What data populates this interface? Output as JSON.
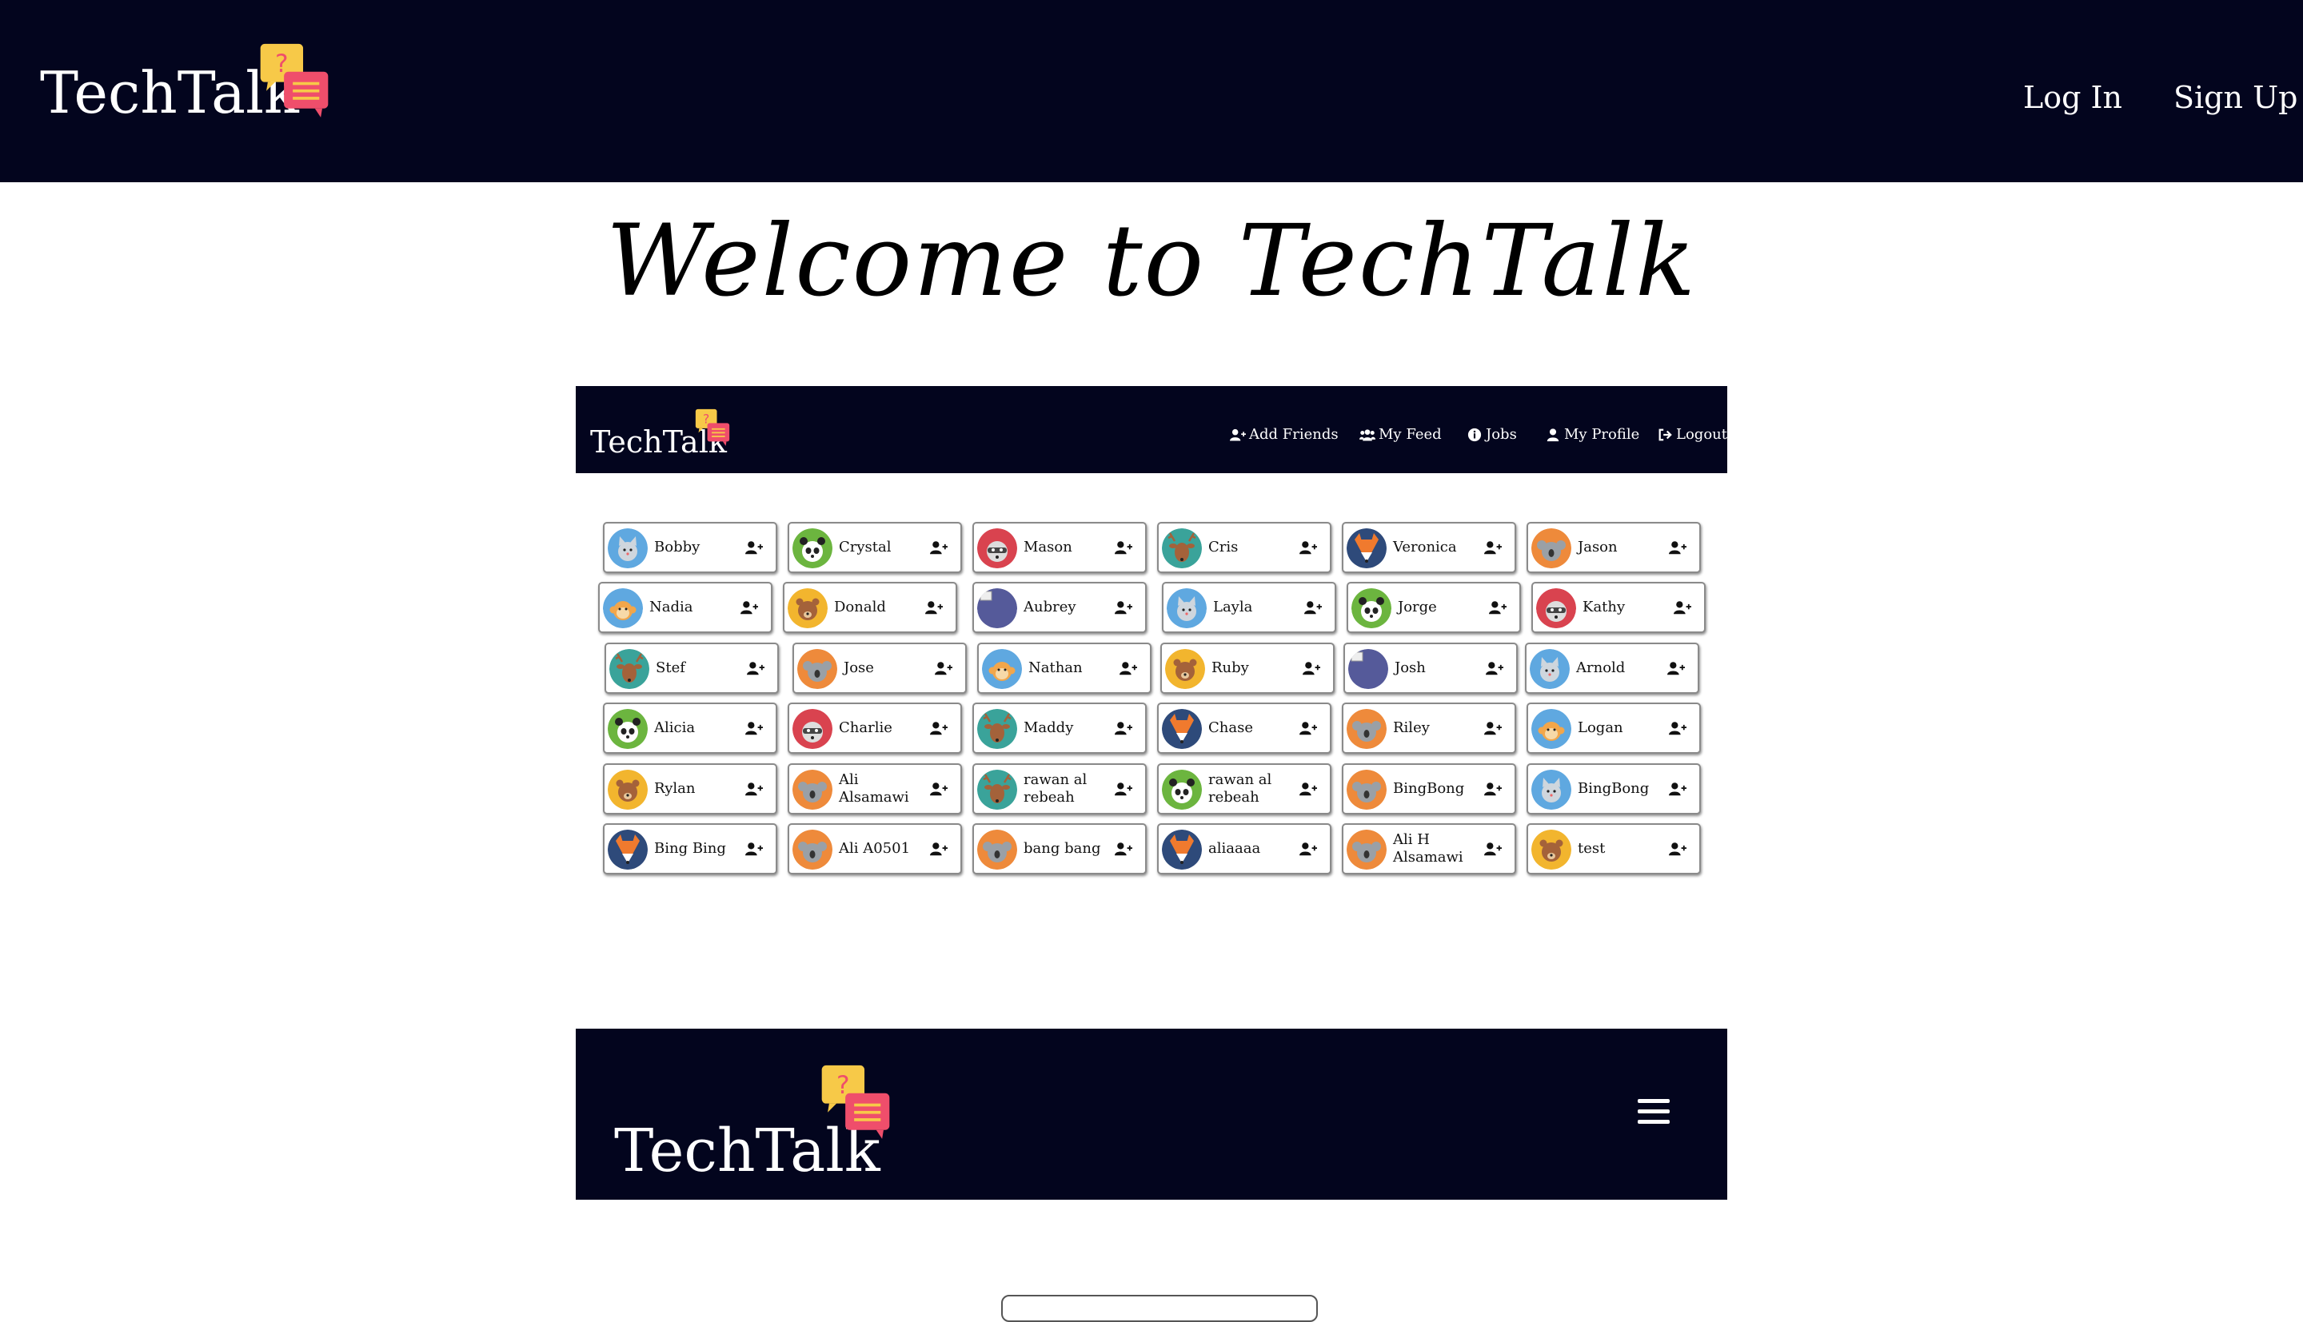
{
  "header": {
    "brand": "TechTalk",
    "login_label": "Log In",
    "signup_label": "Sign Up"
  },
  "welcome_title": "Welcome to TechTalk",
  "preview_nav": {
    "brand": "TechTalk",
    "items": [
      {
        "label": "Add Friends",
        "icon": "user-plus-icon"
      },
      {
        "label": "My Feed",
        "icon": "users-icon"
      },
      {
        "label": "Jobs",
        "icon": "info-icon"
      },
      {
        "label": "My Profile",
        "icon": "user-icon"
      },
      {
        "label": "Logout",
        "icon": "logout-icon"
      }
    ]
  },
  "users": [
    {
      "name": "Bobby",
      "avatar": "cat",
      "color": "#5fa8e0"
    },
    {
      "name": "Crystal",
      "avatar": "panda",
      "color": "#6cb53f"
    },
    {
      "name": "Mason",
      "avatar": "raccoon",
      "color": "#d9434f"
    },
    {
      "name": "Cris",
      "avatar": "deer",
      "color": "#3aa39a"
    },
    {
      "name": "Veronica",
      "avatar": "fox",
      "color": "#2e4a7a"
    },
    {
      "name": "Jason",
      "avatar": "koala",
      "color": "#ee8a3b"
    },
    {
      "name": "Nadia",
      "avatar": "monkey",
      "color": "#5fa8e0"
    },
    {
      "name": "Donald",
      "avatar": "bear",
      "color": "#f2b52e"
    },
    {
      "name": "Aubrey",
      "avatar": "broken",
      "color": "#555a9a"
    },
    {
      "name": "Layla",
      "avatar": "cat",
      "color": "#5fa8e0"
    },
    {
      "name": "Jorge",
      "avatar": "panda",
      "color": "#6cb53f"
    },
    {
      "name": "Kathy",
      "avatar": "raccoon",
      "color": "#d9434f"
    },
    {
      "name": "Stef",
      "avatar": "deer",
      "color": "#3aa39a"
    },
    {
      "name": "Jose",
      "avatar": "koala",
      "color": "#ee8a3b"
    },
    {
      "name": "Nathan",
      "avatar": "monkey",
      "color": "#5fa8e0"
    },
    {
      "name": "Ruby",
      "avatar": "bear",
      "color": "#f2b52e"
    },
    {
      "name": "Josh",
      "avatar": "broken",
      "color": "#555a9a"
    },
    {
      "name": "Arnold",
      "avatar": "cat",
      "color": "#5fa8e0"
    },
    {
      "name": "Alicia",
      "avatar": "panda",
      "color": "#6cb53f"
    },
    {
      "name": "Charlie",
      "avatar": "raccoon",
      "color": "#d9434f"
    },
    {
      "name": "Maddy",
      "avatar": "deer",
      "color": "#3aa39a"
    },
    {
      "name": "Chase",
      "avatar": "fox",
      "color": "#2e4a7a"
    },
    {
      "name": "Riley",
      "avatar": "koala",
      "color": "#ee8a3b"
    },
    {
      "name": "Logan",
      "avatar": "monkey",
      "color": "#5fa8e0"
    },
    {
      "name": "Rylan",
      "avatar": "bear",
      "color": "#f2b52e"
    },
    {
      "name": "Ali Alsamawi",
      "avatar": "koala",
      "color": "#ee8a3b"
    },
    {
      "name": "rawan al rebeah",
      "avatar": "deer",
      "color": "#3aa39a"
    },
    {
      "name": "rawan al rebeah",
      "avatar": "panda",
      "color": "#6cb53f"
    },
    {
      "name": "BingBong",
      "avatar": "koala",
      "color": "#ee8a3b"
    },
    {
      "name": "BingBong",
      "avatar": "cat",
      "color": "#5fa8e0"
    },
    {
      "name": "Bing Bing",
      "avatar": "fox",
      "color": "#2e4a7a"
    },
    {
      "name": "Ali A0501",
      "avatar": "koala",
      "color": "#ee8a3b"
    },
    {
      "name": "bang bang",
      "avatar": "koala",
      "color": "#ee8a3b"
    },
    {
      "name": "aliaaaa",
      "avatar": "fox",
      "color": "#2e4a7a"
    },
    {
      "name": "Ali H Alsamawi",
      "avatar": "koala",
      "color": "#ee8a3b"
    },
    {
      "name": "test",
      "avatar": "bear",
      "color": "#f2b52e"
    }
  ],
  "mobile_preview": {
    "brand": "TechTalk",
    "menu_icon": "hamburger-icon"
  },
  "colors": {
    "navy": "#03051e",
    "logo_yellow": "#f7c948",
    "logo_red": "#ef4e6b"
  }
}
